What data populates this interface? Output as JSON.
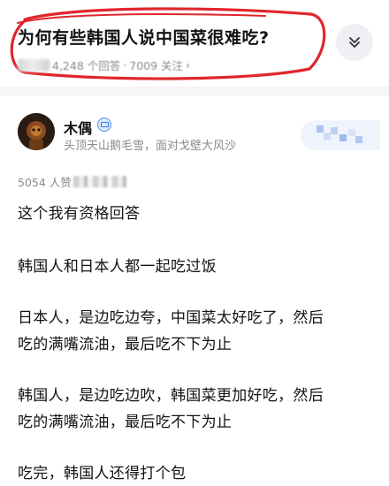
{
  "question": {
    "title": "为何有些韩国人说中国菜很难吃?",
    "answer_count": "4,248 个回答",
    "separator": "·",
    "follower_count": "7009 关注",
    "chevron": "›",
    "collapse_icon": "chevron-double-down-icon"
  },
  "author": {
    "name": "木偶",
    "bio": "头顶天山鹅毛雪，面对戈壁大风沙",
    "badge_icon": "verified-badge-icon"
  },
  "answer": {
    "vote_prefix": "5054 人赞",
    "paragraphs": [
      "这个我有资格回答",
      "韩国人和日本人都一起吃过饭",
      "日本人，是边吃边夸，中国菜太好吃了，然后",
      "吃的满嘴流油，最后吃不下为止",
      "韩国人，是边吃边吹，韩国菜更加好吃，然后",
      "吃的满嘴流油，最后吃不下为止",
      "吃完，韩国人还得打个包"
    ]
  },
  "colors": {
    "annotation_red": "#e0262c",
    "muted_text": "#8a8a8a",
    "accent_blue": "#5a8fe8"
  }
}
